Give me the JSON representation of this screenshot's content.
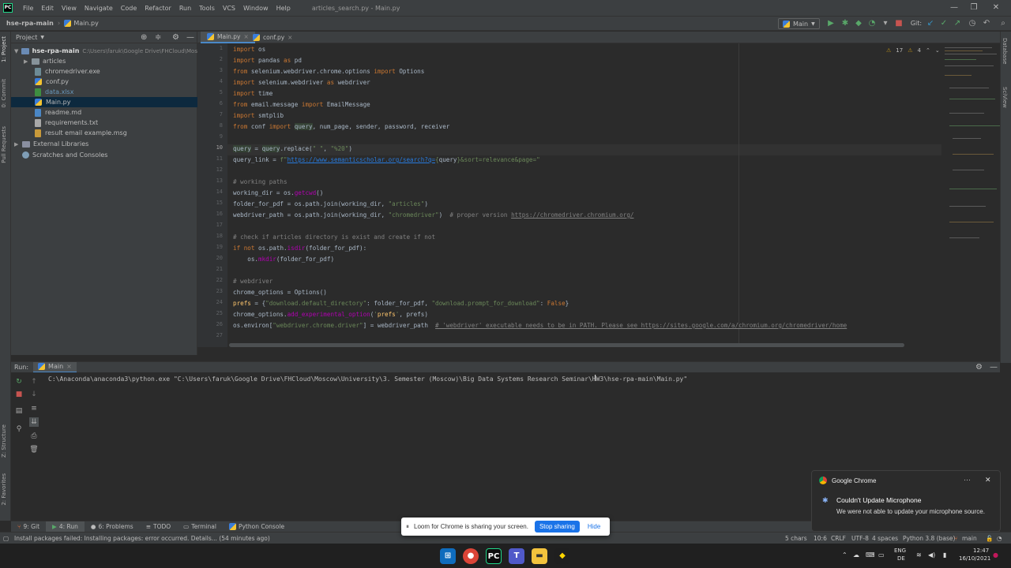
{
  "window": {
    "title": "articles_search.py - Main.py",
    "menu": [
      "File",
      "Edit",
      "View",
      "Navigate",
      "Code",
      "Refactor",
      "Run",
      "Tools",
      "VCS",
      "Window",
      "Help"
    ],
    "minimize": "—",
    "maximize": "❐",
    "close": "✕"
  },
  "navbar": {
    "project": "hse-rpa-main",
    "file": "Main.py",
    "run_config": "Main",
    "git_label": "Git:"
  },
  "left_strip": {
    "project_tab": "1: Project",
    "commit_tab": "0: Commit",
    "pull_requests_tab": "Pull Requests",
    "structure_tab": "Z: Structure",
    "favorites_tab": "2: Favorites"
  },
  "right_strip": {
    "database_tab": "Database",
    "sciview_tab": "SciView"
  },
  "project_panel": {
    "title": "Project",
    "tree": [
      {
        "label": "hse-rpa-main",
        "path": "C:\\Users\\faruk\\Google Drive\\FHCloud\\Mos",
        "type": "root"
      },
      {
        "label": "articles",
        "type": "folder"
      },
      {
        "label": "chromedriver.exe",
        "type": "exe"
      },
      {
        "label": "conf.py",
        "type": "py"
      },
      {
        "label": "data.xlsx",
        "type": "xlsx"
      },
      {
        "label": "Main.py",
        "type": "py",
        "selected": true
      },
      {
        "label": "readme.md",
        "type": "md"
      },
      {
        "label": "requirements.txt",
        "type": "txt"
      },
      {
        "label": "result email example.msg",
        "type": "msg"
      },
      {
        "label": "External Libraries",
        "type": "lib"
      },
      {
        "label": "Scratches and Consoles",
        "type": "scratch"
      }
    ]
  },
  "editor": {
    "tabs": [
      "Main.py",
      "conf.py"
    ],
    "inspections": {
      "warnings": "17",
      "weak_warnings": "4"
    },
    "line_numbers": [
      "1",
      "2",
      "3",
      "4",
      "5",
      "6",
      "7",
      "8",
      "9",
      "10",
      "11",
      "12",
      "13",
      "14",
      "15",
      "16",
      "17",
      "18",
      "19",
      "20",
      "21",
      "22",
      "23",
      "24",
      "25",
      "26",
      "27"
    ]
  },
  "run_panel": {
    "label": "Run:",
    "tab": "Main",
    "command": "C:\\Anaconda\\anaconda3\\python.exe \"C:\\Users\\faruk\\Google Drive\\FHCloud\\Moscow\\University\\3. Semester (Moscow)\\Big Data Systems Research Seminar\\HW3\\hse-rpa-main\\Main.py\""
  },
  "tool_tabs": [
    "9: Git",
    "4: Run",
    "6: Problems",
    "TODO",
    "Terminal",
    "Python Console"
  ],
  "status": {
    "message": "Install packages failed: Installing packages: error occurred. Details... (54 minutes ago)",
    "chars": "5 chars",
    "position": "10:6",
    "line_sep": "CRLF",
    "encoding": "UTF-8",
    "indent": "4 spaces",
    "interpreter": "Python 3.8 (base)",
    "branch": "main"
  },
  "loom": {
    "text": "Loom for Chrome is sharing your screen.",
    "stop": "Stop sharing",
    "hide": "Hide"
  },
  "toast": {
    "app": "Google Chrome",
    "title": "Couldn't Update Microphone",
    "body": "We were not able to update your microphone source."
  },
  "taskbar": {
    "lang": "ENG",
    "layout": "DE",
    "time": "12:47",
    "date": "16/10/2021"
  },
  "colors": {
    "editor_bg": "#2b2b2b",
    "panel_bg": "#3c3f41",
    "keyword": "#cc7832",
    "string": "#6a8759",
    "comment": "#808080",
    "accent": "#4a88c7"
  }
}
